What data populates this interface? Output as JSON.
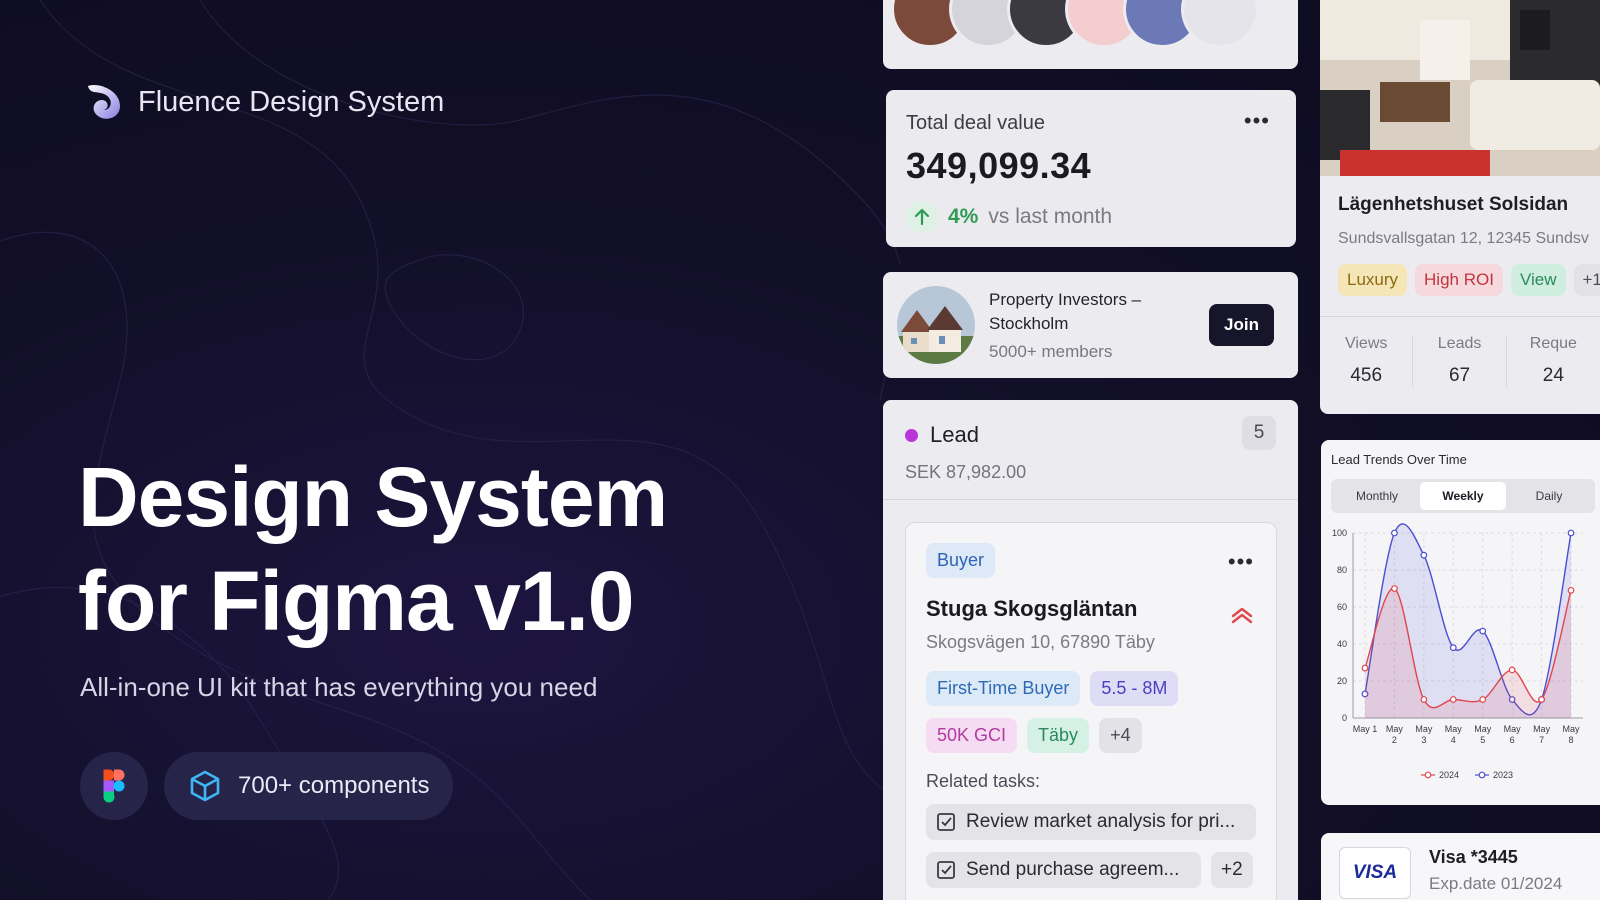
{
  "brand": {
    "name": "Fluence Design System",
    "logo_icon": "fluence-swirl-icon"
  },
  "hero": {
    "title_line1": "Design System",
    "title_line2": "for Figma v1.0",
    "subtitle": "All-in-one UI kit that has everything you need",
    "components_label": "700+ components",
    "figma_icon": "figma-icon",
    "components_icon": "cube-icon"
  },
  "deal": {
    "label": "Total deal value",
    "value": "349,099.34",
    "change": "4%",
    "change_suffix": "vs last month",
    "accent_color": "#2e9b52"
  },
  "group": {
    "name": "Property Investors – Stockholm",
    "members": "5000+ members",
    "join_label": "Join"
  },
  "lead": {
    "title": "Lead",
    "count": "5",
    "amount": "SEK 87,982.00",
    "dot_color": "#b935d9",
    "card": {
      "type_tag": "Buyer",
      "title": "Stuga Skogsgläntan",
      "address": "Skogsvägen 10, 67890 Täby",
      "tags": [
        "First-Time Buyer",
        "5.5 - 8M",
        "50K GCI",
        "Täby",
        "+4"
      ],
      "related_label": "Related tasks:",
      "tasks": [
        "Review market analysis for pri...",
        "Send purchase agreem..."
      ],
      "more_tasks": "+2"
    }
  },
  "listing": {
    "title": "Lägenhetshuset Solsidan",
    "address": "Sundsvallsgatan 12, 12345 Sundsv",
    "tags": [
      "Luxury",
      "High ROI",
      "View",
      "+1"
    ],
    "stats": [
      {
        "label": "Views",
        "value": "456"
      },
      {
        "label": "Leads",
        "value": "67"
      },
      {
        "label": "Reque",
        "value": "24"
      }
    ]
  },
  "chart": {
    "title": "Lead Trends Over Time",
    "tabs": [
      "Monthly",
      "Weekly",
      "Daily"
    ],
    "active_tab": "Weekly"
  },
  "chart_data": {
    "type": "line",
    "title": "Lead Trends Over Time",
    "x": [
      "May 1",
      "May 2",
      "May 3",
      "May 4",
      "May 5",
      "May 6",
      "May 7",
      "May 8"
    ],
    "yticks": [
      0,
      20,
      40,
      60,
      80,
      100
    ],
    "ylim": [
      0,
      100
    ],
    "series": [
      {
        "name": "2024",
        "color": "#e0464c",
        "values": [
          27,
          70,
          10,
          10,
          10,
          26,
          10,
          69
        ]
      },
      {
        "name": "2023",
        "color": "#4b4ed0",
        "values": [
          13,
          100,
          88,
          38,
          47,
          10,
          10,
          100
        ]
      }
    ],
    "legend": "bottom",
    "grid": true
  },
  "visa": {
    "name": "Visa *3445",
    "expiry": "Exp.date 01/2024",
    "logo_text": "VISA"
  }
}
